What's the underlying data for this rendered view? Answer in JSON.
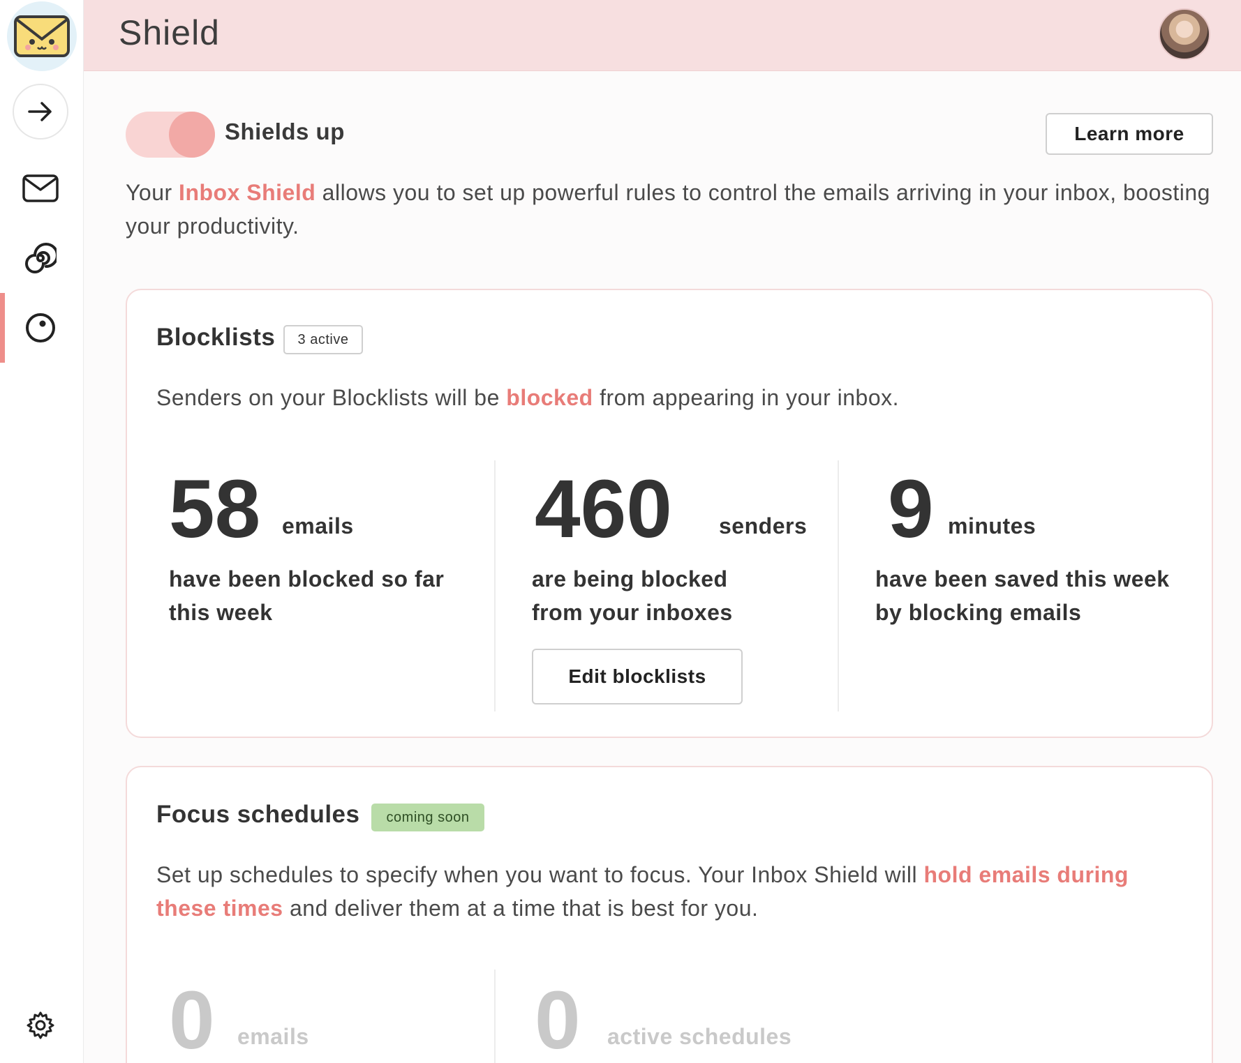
{
  "header": {
    "title": "Shield"
  },
  "sidebar": {
    "icons": [
      "envelope-logo-icon",
      "arrow-right-icon",
      "mail-icon",
      "spiral-icon",
      "shield-icon",
      "gear-icon"
    ],
    "active_index": 4
  },
  "shields": {
    "label": "Shields up",
    "on": true
  },
  "learn_more": "Learn more",
  "intro": {
    "prefix": "Your ",
    "highlight": "Inbox Shield",
    "suffix": " allows you to set up powerful rules to control the emails arriving in your inbox, boosting your productivity."
  },
  "blocklists": {
    "title": "Blocklists",
    "badge": "3 active",
    "desc_prefix": "Senders on your Blocklists will be ",
    "desc_highlight": "blocked",
    "desc_suffix": " from appearing in your inbox.",
    "stats": [
      {
        "value": "58",
        "unit": "emails",
        "desc": "have been blocked so far this week"
      },
      {
        "value": "460",
        "unit": "senders",
        "desc": "are being blocked from your inboxes"
      },
      {
        "value": "9",
        "unit": "minutes",
        "desc": "have been saved this week by blocking emails"
      }
    ],
    "edit_button": "Edit blocklists"
  },
  "focus": {
    "title": "Focus schedules",
    "badge": "coming soon",
    "desc_prefix": "Set up schedules to specify when you want to focus. Your Inbox Shield will ",
    "desc_highlight": "hold emails during these times",
    "desc_suffix": " and deliver them at a time that is best for you.",
    "stats": [
      {
        "value": "0",
        "unit": "emails"
      },
      {
        "value": "0",
        "unit": "active schedules"
      }
    ]
  },
  "colors": {
    "accent": "#e87c78",
    "header_bg": "#f7dfe0",
    "toggle_track": "#f9d4d3",
    "toggle_knob": "#f2a9a6",
    "badge_soon_bg": "#b9dca8"
  }
}
